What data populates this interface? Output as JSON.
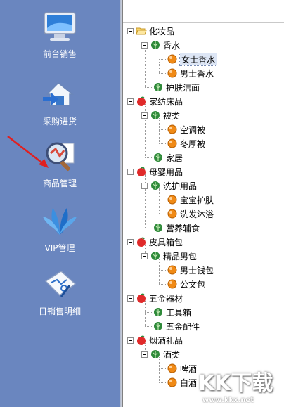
{
  "sidebar": {
    "items": [
      {
        "label": "前台销售",
        "icon": "monitor-icon"
      },
      {
        "label": "采购进货",
        "icon": "house-arrow-icon"
      },
      {
        "label": "商品管理",
        "icon": "magnifier-icon"
      },
      {
        "label": "VIP管理",
        "icon": "vip-leaf-icon"
      },
      {
        "label": "日销售明细",
        "icon": "chart-icon"
      }
    ]
  },
  "tree": {
    "root": "化妆品",
    "nodes": [
      {
        "label": "香水"
      },
      {
        "label": "女士香水"
      },
      {
        "label": "男士香水"
      },
      {
        "label": "护肤洁面"
      },
      {
        "label": "家纺床品"
      },
      {
        "label": "被类"
      },
      {
        "label": "空调被"
      },
      {
        "label": "冬厚被"
      },
      {
        "label": "家居"
      },
      {
        "label": "母婴用品"
      },
      {
        "label": "洗护用品"
      },
      {
        "label": "宝宝护肤"
      },
      {
        "label": "洗发沐浴"
      },
      {
        "label": "营养辅食"
      },
      {
        "label": "皮具箱包"
      },
      {
        "label": "精品男包"
      },
      {
        "label": "男士钱包"
      },
      {
        "label": "公文包"
      },
      {
        "label": "五金器材"
      },
      {
        "label": "工具箱"
      },
      {
        "label": "五金配件"
      },
      {
        "label": "烟酒礼品"
      },
      {
        "label": "酒类"
      },
      {
        "label": "啤酒"
      },
      {
        "label": "白酒"
      }
    ]
  },
  "watermark": {
    "brand": "KK下载",
    "url": "www.kkx.net"
  },
  "colors": {
    "sidebar": "#6a86bf",
    "selection": "#dde6f5"
  }
}
